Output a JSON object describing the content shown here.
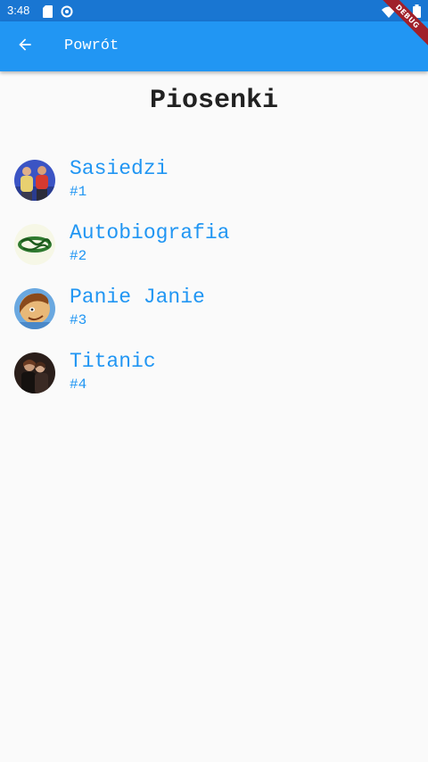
{
  "status_bar": {
    "time": "3:48",
    "icons": [
      "sd-card-icon",
      "sync-icon",
      "wifi-icon",
      "battery-icon"
    ]
  },
  "app_bar": {
    "back_icon": "arrow-back-icon",
    "title": "Powrót",
    "background": "#2196f3"
  },
  "debug_banner": {
    "label": "DEBUG",
    "color": "#a0202a"
  },
  "page": {
    "title": "Piosenki"
  },
  "songs": [
    {
      "title": "Sasiedzi",
      "number": "#1",
      "thumbnail": "two-people-photo"
    },
    {
      "title": "Autobiografia",
      "number": "#2",
      "thumbnail": "band-logo"
    },
    {
      "title": "Panie Janie",
      "number": "#3",
      "thumbnail": "cartoon-face"
    },
    {
      "title": "Titanic",
      "number": "#4",
      "thumbnail": "movie-couple-photo"
    }
  ],
  "colors": {
    "accent": "#2196f3",
    "status_bar": "#1976d2",
    "background": "#fafafa",
    "title_text": "#212121"
  }
}
